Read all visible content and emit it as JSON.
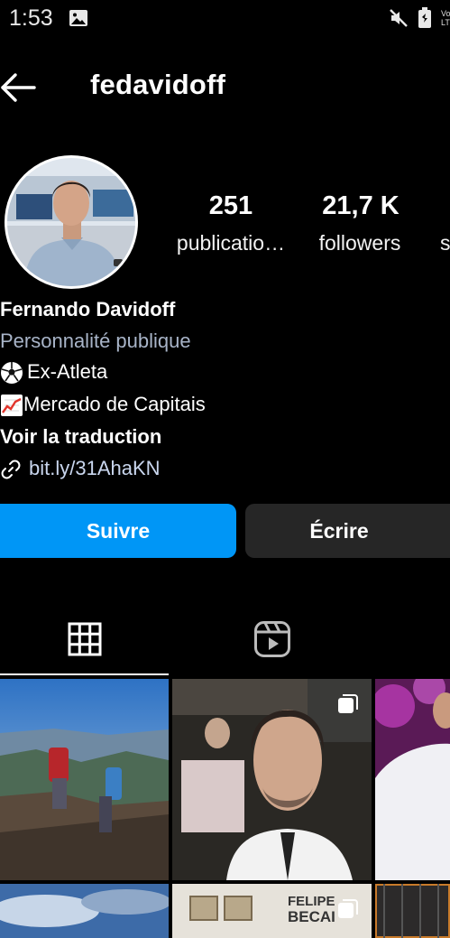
{
  "status_bar": {
    "time": "1:53",
    "carrier": "Vo LT"
  },
  "header": {
    "username": "fedavidoff"
  },
  "stats": [
    {
      "value": "251",
      "label": "publicatio…"
    },
    {
      "value": "21,7 K",
      "label": "followers"
    },
    {
      "value": "",
      "label": "s"
    }
  ],
  "bio": {
    "name": "Fernando Davidoff",
    "category": "Personnalité publique",
    "line1": "Ex-Atleta",
    "line2": "Mercado de Capitais",
    "translate": "Voir la traduction",
    "link": "bit.ly/31AhaKN"
  },
  "actions": {
    "follow": "Suivre",
    "message": "Écrire"
  },
  "posts": [
    {
      "type": "photo",
      "alt": ""
    },
    {
      "type": "multi",
      "alt": ""
    },
    {
      "type": "photo",
      "alt": ""
    },
    {
      "type": "photo",
      "alt": ""
    },
    {
      "type": "multi",
      "alt": ""
    },
    {
      "type": "photo",
      "alt": ""
    }
  ],
  "colors": {
    "accent": "#0096f6",
    "button_secondary": "#262626",
    "background": "#000000"
  }
}
